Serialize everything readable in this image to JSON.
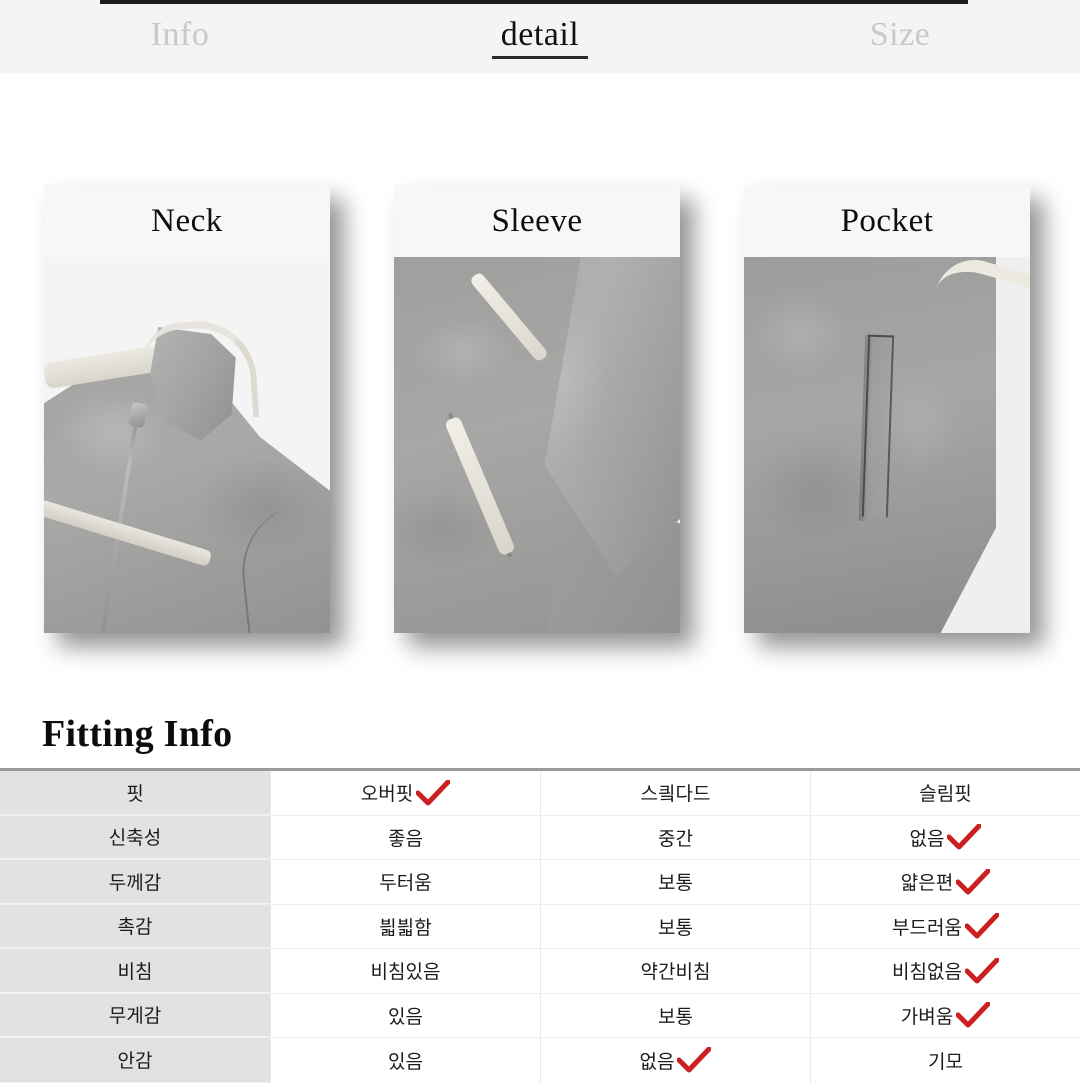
{
  "tabs": [
    {
      "label": "Info",
      "active": false
    },
    {
      "label": "detail",
      "active": true
    },
    {
      "label": "Size",
      "active": false
    }
  ],
  "detail_cards": [
    {
      "title": "Neck",
      "image_alt": "grey zip-up jacket collar and neckline close-up"
    },
    {
      "title": "Sleeve",
      "image_alt": "grey jacket sleeve cuff with contrast trim close-up"
    },
    {
      "title": "Pocket",
      "image_alt": "grey jacket welt pocket close-up"
    }
  ],
  "fitting": {
    "heading": "Fitting Info",
    "rows": [
      {
        "label": "핏",
        "options": [
          {
            "text": "오버핏",
            "checked": true
          },
          {
            "text": "스킠다드",
            "checked": false
          },
          {
            "text": "슬림핏",
            "checked": false
          }
        ]
      },
      {
        "label": "신축성",
        "options": [
          {
            "text": "좋음",
            "checked": false
          },
          {
            "text": "중간",
            "checked": false
          },
          {
            "text": "없음",
            "checked": true
          }
        ]
      },
      {
        "label": "두께감",
        "options": [
          {
            "text": "두터움",
            "checked": false
          },
          {
            "text": "보통",
            "checked": false
          },
          {
            "text": "얇은편",
            "checked": true
          }
        ]
      },
      {
        "label": "촉감",
        "options": [
          {
            "text": "븳븳함",
            "checked": false
          },
          {
            "text": "보통",
            "checked": false
          },
          {
            "text": "부드러움",
            "checked": true
          }
        ]
      },
      {
        "label": "비침",
        "options": [
          {
            "text": "비침있음",
            "checked": false
          },
          {
            "text": "약간비침",
            "checked": false
          },
          {
            "text": "비침없음",
            "checked": true
          }
        ]
      },
      {
        "label": "무게감",
        "options": [
          {
            "text": "있음",
            "checked": false
          },
          {
            "text": "보통",
            "checked": false
          },
          {
            "text": "가벼움",
            "checked": true
          }
        ]
      },
      {
        "label": "안감",
        "options": [
          {
            "text": "있음",
            "checked": false
          },
          {
            "text": "없음",
            "checked": true
          },
          {
            "text": "기모",
            "checked": false
          }
        ]
      }
    ]
  },
  "colors": {
    "check_mark": "#cc1f1f",
    "tab_active_text": "#111111",
    "tab_inactive_text": "#c9c9cb",
    "table_label_bg": "#e2e2e2",
    "table_border": "#9a9a9a",
    "topbar_line": "#1b1b1b"
  }
}
